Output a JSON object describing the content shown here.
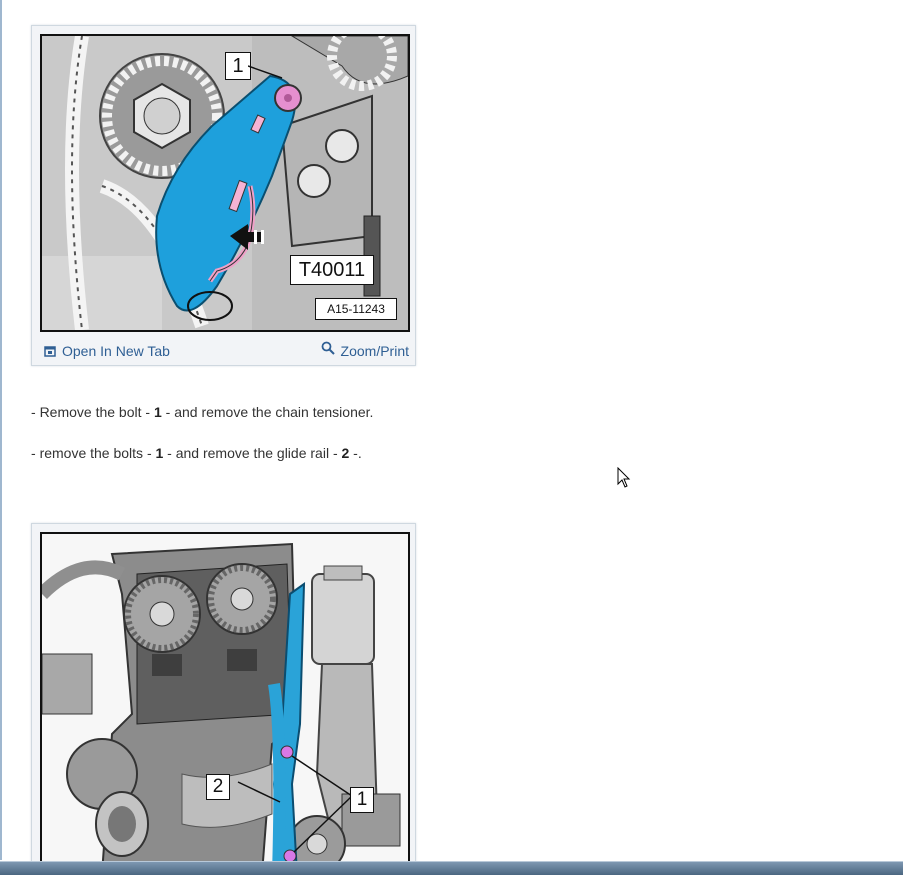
{
  "figure1": {
    "callout_bolt": "1",
    "callout_tool": "T40011",
    "ref_code": "A15-11243",
    "open_label": "Open In New Tab",
    "zoom_label": "Zoom/Print",
    "colors": {
      "tensioner": "#1ea0dc",
      "bolt": "#e58fcf",
      "tool_wire": "#f0a0c8"
    }
  },
  "steps": [
    {
      "prefix": "- ",
      "text_a": "Remove the bolt - ",
      "bold_a": "1",
      "text_b": " - and remove the chain tensioner.",
      "bold_b": "",
      "text_c": ""
    },
    {
      "prefix": "- ",
      "text_a": "remove the bolts - ",
      "bold_a": "1",
      "text_b": " - and remove the glide rail - ",
      "bold_b": "2",
      "text_c": " -."
    }
  ],
  "figure2": {
    "callout_rail": "2",
    "callout_bolts": "1",
    "colors": {
      "glide_rail": "#2aa3d8",
      "bolt": "#d878e6"
    }
  },
  "icons": {
    "open": "open-in-new-tab-icon",
    "zoom": "magnifier-icon",
    "cursor": "mouse-pointer-icon"
  }
}
